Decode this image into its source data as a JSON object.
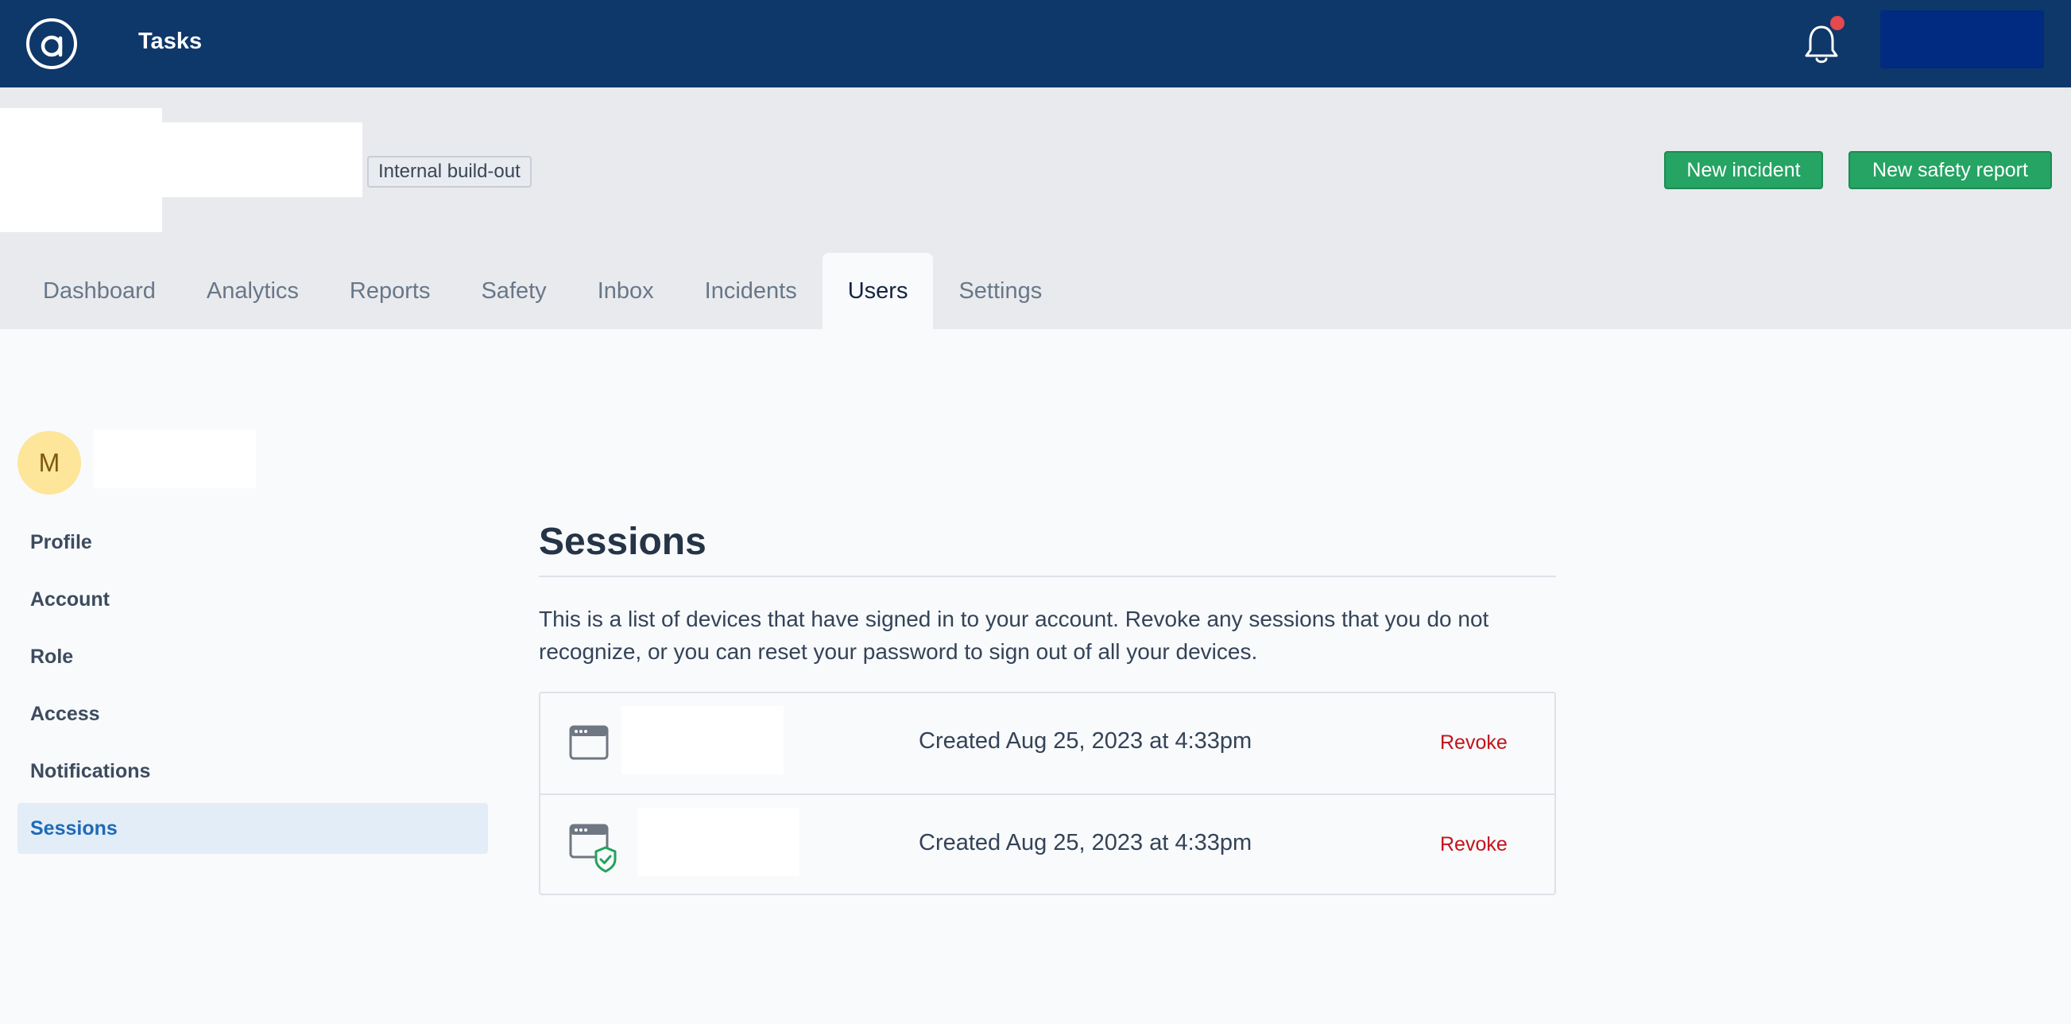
{
  "topbar": {
    "logo_icon": "at-sign-logo-icon",
    "app_title": "Tasks",
    "notification_icon": "bell-icon",
    "colors": {
      "bar": "#0e376a",
      "badge": "#e5484d"
    }
  },
  "header": {
    "tag": "Internal build-out",
    "actions": {
      "new_incident": "New incident",
      "new_safety_report": "New safety report"
    },
    "colors": {
      "primary_button": "#25a464"
    }
  },
  "tabs": [
    {
      "label": "Dashboard",
      "active": false
    },
    {
      "label": "Analytics",
      "active": false
    },
    {
      "label": "Reports",
      "active": false
    },
    {
      "label": "Safety",
      "active": false
    },
    {
      "label": "Inbox",
      "active": false
    },
    {
      "label": "Incidents",
      "active": false
    },
    {
      "label": "Users",
      "active": true
    },
    {
      "label": "Settings",
      "active": false
    }
  ],
  "user": {
    "initial": "M"
  },
  "sidebar": {
    "items": [
      {
        "label": "Profile",
        "active": false
      },
      {
        "label": "Account",
        "active": false
      },
      {
        "label": "Role",
        "active": false
      },
      {
        "label": "Access",
        "active": false
      },
      {
        "label": "Notifications",
        "active": false
      },
      {
        "label": "Sessions",
        "active": true
      }
    ]
  },
  "main": {
    "title": "Sessions",
    "description": "This is a list of devices that have signed in to your account. Revoke any sessions that you do not recognize, or you can reset your password to sign out of all your devices.",
    "sessions": [
      {
        "icon": "browser-window-icon",
        "created": "Created Aug 25, 2023 at 4:33pm",
        "action": "Revoke"
      },
      {
        "icon": "browser-window-shield-icon",
        "created": "Created Aug 25, 2023 at 4:33pm",
        "action": "Revoke"
      }
    ],
    "colors": {
      "revoke": "#c3131b",
      "shield": "#22a35a"
    }
  }
}
